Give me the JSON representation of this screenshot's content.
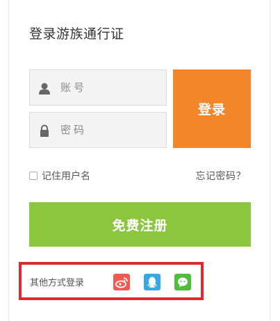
{
  "title": "登录游族通行证",
  "username": {
    "placeholder": "账号"
  },
  "password": {
    "placeholder": "密码"
  },
  "login_button": "登录",
  "remember_label": "记住用户名",
  "forgot_link": "忘记密码？",
  "register_button": "免费注册",
  "other_login_label": "其他方式登录",
  "social_icons": [
    "weibo-icon",
    "qq-icon",
    "wechat-icon"
  ],
  "colors": {
    "login_orange": "#f4862a",
    "register_green": "#8cc63f",
    "highlight_red": "#e32a2a",
    "weibo": "#f05a51",
    "qq": "#35a9e6",
    "wechat": "#4fbe3a"
  }
}
